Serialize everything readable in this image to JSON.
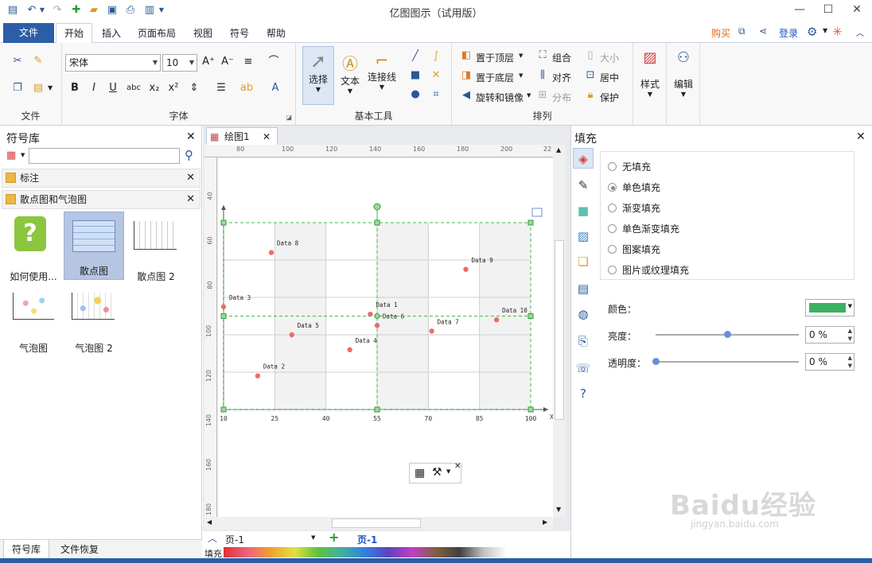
{
  "window": {
    "title": "亿图图示（试用版）"
  },
  "menu": {
    "tabs": [
      {
        "label": "文件"
      },
      {
        "label": "开始"
      },
      {
        "label": "插入"
      },
      {
        "label": "页面布局"
      },
      {
        "label": "视图"
      },
      {
        "label": "符号"
      },
      {
        "label": "帮助"
      }
    ],
    "buy": "购买",
    "login": "登录"
  },
  "ribbon": {
    "groups": {
      "file": "文件",
      "font": "字体",
      "basic_tools": "基本工具",
      "arrange": "排列"
    },
    "font_name": "宋体",
    "font_size": "10",
    "select": "选择",
    "text": "文本",
    "connector": "连接线",
    "bring_front": "置于顶层",
    "send_back": "置于底层",
    "rotate_mirror": "旋转和镜像",
    "group": "组合",
    "align": "对齐",
    "distribute": "分布",
    "size": "大小",
    "center": "居中",
    "protect": "保护",
    "style": "样式",
    "edit": "编辑"
  },
  "library": {
    "title": "符号库",
    "categories": [
      {
        "label": "标注"
      },
      {
        "label": "散点图和气泡图"
      }
    ],
    "symbols": [
      {
        "label": "如何使用..."
      },
      {
        "label": "散点图"
      },
      {
        "label": "散点图 2"
      },
      {
        "label": "气泡图"
      },
      {
        "label": "气泡图 2"
      }
    ],
    "bottom_tabs": [
      {
        "label": "符号库"
      },
      {
        "label": "文件恢复"
      }
    ]
  },
  "document": {
    "tab": "绘图1",
    "ruler_top": [
      "80",
      "100",
      "120",
      "140",
      "160",
      "180",
      "200",
      "22"
    ],
    "ruler_left": [
      "40",
      "60",
      "80",
      "100",
      "120",
      "140",
      "160",
      "180"
    ],
    "page_label": "页-1",
    "page_current": "页-1",
    "fill_label": "填充"
  },
  "chart_data": {
    "type": "scatter",
    "x_ticks": [
      "10",
      "25",
      "40",
      "55",
      "70",
      "85",
      "100"
    ],
    "axis_x_label": "X",
    "xlim": [
      10,
      100
    ],
    "points": [
      {
        "label": "Data 1",
        "x": 53,
        "y": 0.51
      },
      {
        "label": "Data 2",
        "x": 20,
        "y": 0.18
      },
      {
        "label": "Data 3",
        "x": 10,
        "y": 0.55
      },
      {
        "label": "Data 4",
        "x": 47,
        "y": 0.32
      },
      {
        "label": "Data 5",
        "x": 30,
        "y": 0.4
      },
      {
        "label": "Data 6",
        "x": 55,
        "y": 0.45
      },
      {
        "label": "Data 7",
        "x": 71,
        "y": 0.42
      },
      {
        "label": "Data 8",
        "x": 24,
        "y": 0.84
      },
      {
        "label": "Data 9",
        "x": 81,
        "y": 0.75
      },
      {
        "label": "Data 10",
        "x": 90,
        "y": 0.48
      }
    ],
    "point_color": "#f06a6a"
  },
  "fill_panel": {
    "title": "填充",
    "options": [
      {
        "label": "无填充",
        "selected": false
      },
      {
        "label": "单色填充",
        "selected": true
      },
      {
        "label": "渐变填充",
        "selected": false
      },
      {
        "label": "单色渐变填充",
        "selected": false
      },
      {
        "label": "图案填充",
        "selected": false
      },
      {
        "label": "图片或纹理填充",
        "selected": false
      }
    ],
    "color_label": "颜色：",
    "color_value": "#3cb063",
    "brightness_label": "亮度：",
    "brightness_value": "0 %",
    "brightness_level": 0.5,
    "transparency_label": "透明度：",
    "transparency_value": "0 %",
    "transparency_level": 0
  },
  "watermark": {
    "brand": "Baidu经验",
    "url": "jingyan.baidu.com"
  }
}
